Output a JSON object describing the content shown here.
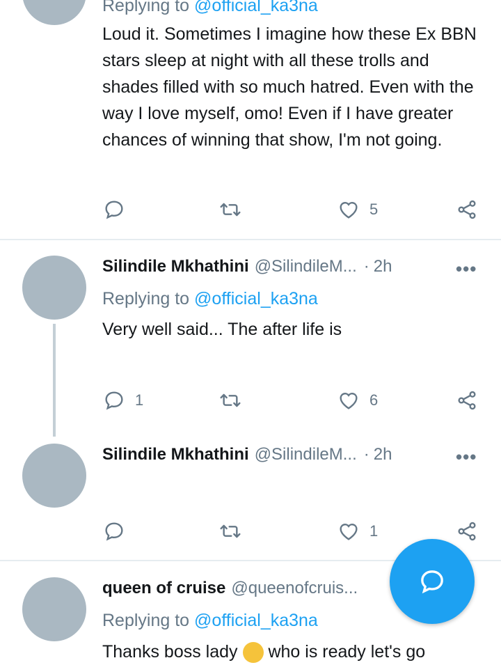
{
  "tweets": [
    {
      "reply_prefix": "Replying to",
      "reply_mention": "@official_ka3na",
      "text": "Loud it. Sometimes I imagine how these Ex BBN stars sleep at night with all these trolls and shades filled with so much hatred. Even with the way I love myself, omo! Even if I have greater chances of winning that show, I'm not going.",
      "replies": "",
      "likes": "5"
    },
    {
      "name": "Silindile Mkhathini",
      "handle": "@SilindileM...",
      "dot": "·",
      "time": "2h",
      "reply_prefix": "Replying to",
      "reply_mention": "@official_ka3na",
      "text": "Very well said... The after life is",
      "replies": "1",
      "likes": "6"
    },
    {
      "name": "Silindile Mkhathini",
      "handle": "@SilindileM...",
      "dot": "·",
      "time": "2h",
      "replies": "",
      "likes": "1"
    },
    {
      "name": "queen of cruise",
      "handle": "@queenofcruis...",
      "reply_prefix": "Replying to",
      "reply_mention": "@official_ka3na",
      "text_before_emoji": "Thanks boss lady",
      "text_after_emoji": "who is ready let's go"
    }
  ],
  "more_label": "•••",
  "icons": {
    "reply": "reply-icon",
    "retweet": "retweet-icon",
    "like": "heart-icon",
    "share": "share-icon",
    "compose": "compose-reply-icon"
  },
  "colors": {
    "accent": "#1da1f2",
    "secondary_text": "#657786",
    "avatar_placeholder": "#aab8c2"
  }
}
